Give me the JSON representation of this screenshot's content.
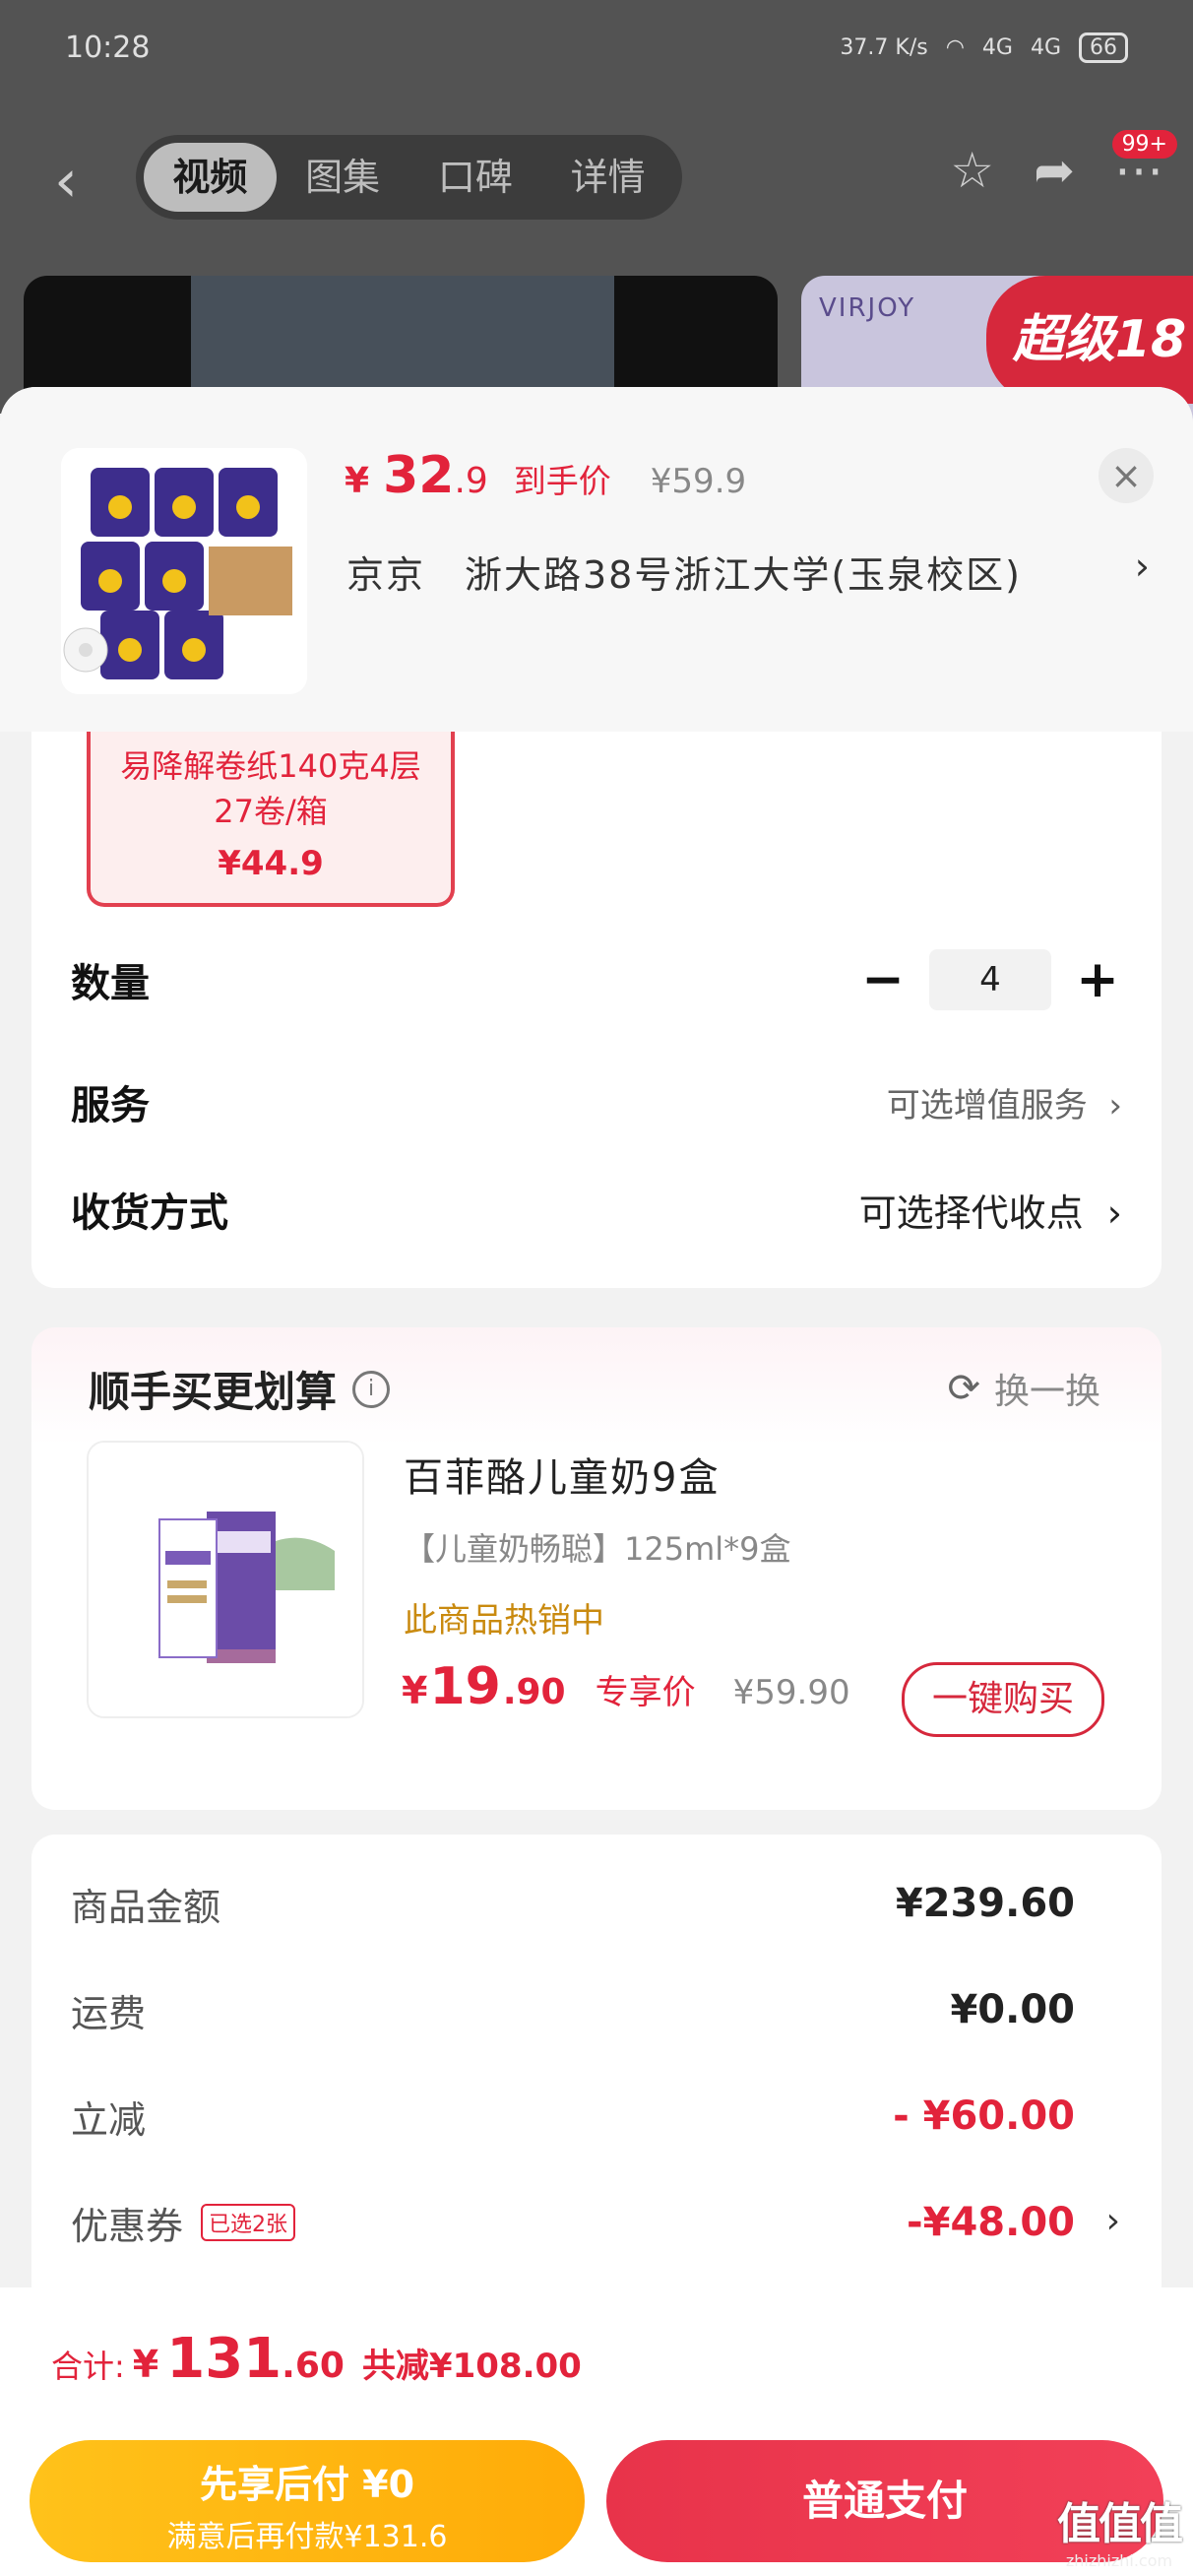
{
  "status_bar": {
    "time": "10:28",
    "net_speed": "37.7 K/s",
    "signal1": "4G",
    "signal2": "4G",
    "battery": "66"
  },
  "nav": {
    "tabs": [
      {
        "label": "视频"
      },
      {
        "label": "图集"
      },
      {
        "label": "口碑"
      },
      {
        "label": "详情"
      }
    ],
    "badge": "99+"
  },
  "bg_banner": {
    "brand": "VIRJOY",
    "promo": "超级18"
  },
  "product": {
    "price_currency": "¥",
    "price_int": "32",
    "price_dec": ".9",
    "price_tag": "到手价",
    "price_old": "¥59.9",
    "address": "京京　浙大路38号浙江大学(玉泉校区)",
    "spec_name": "易降解卷纸140克4层27卷/箱",
    "spec_price": "¥44.9"
  },
  "options": {
    "quantity_label": "数量",
    "quantity_value": "4",
    "service_label": "服务",
    "service_value": "可选增值服务",
    "delivery_label": "收货方式",
    "delivery_value": "可选择代收点"
  },
  "recommend": {
    "title": "顺手买更划算",
    "swap_label": "换一换",
    "name": "百菲酪儿童奶9盒",
    "desc": "【儿童奶畅聪】125ml*9盒",
    "hot": "此商品热销中",
    "price_currency": "¥",
    "price_int": "19",
    "price_dec": ".90",
    "price_tag": "专享价",
    "price_old": "¥59.90",
    "buy_label": "一键购买"
  },
  "summary": {
    "rows": [
      {
        "label": "商品金额",
        "value": "¥239.60"
      },
      {
        "label": "运费",
        "value": "¥0.00"
      },
      {
        "label": "立减",
        "value": "- ¥60.00"
      },
      {
        "label": "优惠券",
        "chip": "已选2张",
        "value": "-¥48.00"
      }
    ]
  },
  "footer": {
    "total_label": "合计:",
    "total_currency": "¥",
    "total_int": "131",
    "total_dec": ".60",
    "saved": "共减¥108.00",
    "pay_later_title": "先享后付 ¥0",
    "pay_later_sub": "满意后再付款¥131.6",
    "pay_normal": "普通支付"
  },
  "watermark": {
    "main": "值值值",
    "sub": "zhizhizhi.com"
  },
  "colors": {
    "accent": "#e2233b",
    "pay_later": "#ffb50f",
    "hot": "#c98a0f"
  }
}
